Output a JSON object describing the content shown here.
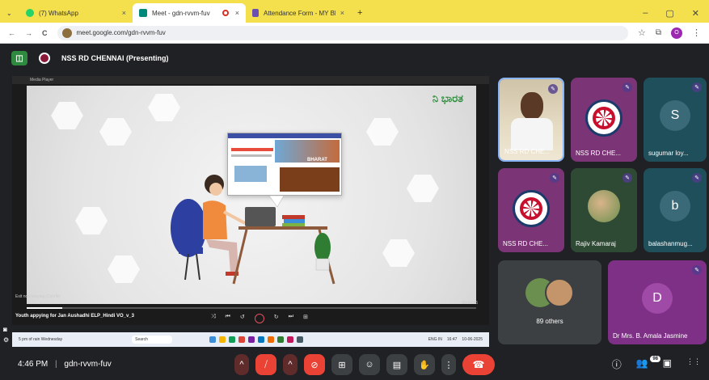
{
  "browser": {
    "tabs": [
      {
        "label": "(7) WhatsApp",
        "color": "#25d366"
      },
      {
        "label": "Meet - gdn-rvvm-fuv",
        "color": "#00897b"
      },
      {
        "label": "Attendance Form - MY Bharat !",
        "color": "#6a4fb3"
      }
    ],
    "new_tab": "+",
    "close_glyph": "×",
    "minimize_glyph": "–",
    "restore_glyph": "▢",
    "window_close_glyph": "✕",
    "back_glyph": "←",
    "forward_glyph": "→",
    "reload_glyph": "C",
    "star_glyph": "☆",
    "extensions_glyph": "⧉",
    "menu_glyph": "⋮",
    "profile_initial": "O",
    "url": "meet.google.com/gdn-rvvm-fuv"
  },
  "meet": {
    "layout_glyph": "◫",
    "presenter": "NSS RD CHENNAI (Presenting)",
    "media_player_title": "Media Player",
    "video_logo": "ನಿ ಭಾರತ",
    "web_card_title": "BHARAT",
    "now_playing": "Youth appying for Jan Aushadhi ELP_Hindi VO_v_3",
    "now_playing_small": "Exit now playing (Ctrl+N)",
    "playback_time": "00:04:56",
    "playback_progress": 0.08,
    "player_controls": [
      "⤨",
      "⏮",
      "↺",
      "↻",
      "⏭",
      "⊞"
    ],
    "taskbar_search": "Search",
    "taskbar_weather": "5 pm of rain Wednesday",
    "taskbar_time": "16:47",
    "taskbar_date": "10-06-2025",
    "taskbar_lang": "ENG IN",
    "participants": [
      {
        "name": "NSS RD CHE...",
        "type": "video",
        "bg": "#3a3a3a"
      },
      {
        "name": "NSS RD CHE...",
        "type": "logo",
        "bg": "#7b3475"
      },
      {
        "name": "sugumar loy...",
        "type": "letter",
        "letter": "S",
        "bg": "#1f4f5b",
        "avatar": "#3a6a78"
      },
      {
        "name": "NSS RD CHE...",
        "type": "logo",
        "bg": "#7b3475"
      },
      {
        "name": "Rajiv Kamaraj",
        "type": "photo",
        "bg": "#2f4a34"
      },
      {
        "name": "balashanmug...",
        "type": "letter",
        "letter": "b",
        "bg": "#1f4f5b",
        "avatar": "#3a6a78"
      },
      {
        "name": "89 others",
        "type": "others",
        "bg": "#3c4043"
      },
      {
        "name": "Dr Mrs. B. Amala Jasmine",
        "type": "letter",
        "letter": "D",
        "bg": "#7e2f86",
        "avatar": "#a04aa8"
      }
    ],
    "mic_glyph": "✎",
    "time": "4:46 PM",
    "separator": "|",
    "meeting_code": "gdn-rvvm-fuv",
    "participant_count": "98",
    "controls": {
      "chevron": "^",
      "mic_off": "⧸",
      "camera_off": "⊘",
      "present": "⊞",
      "emoji": "☺",
      "captions": "▤",
      "raise_hand": "✋",
      "more": "⋮",
      "end_call": "☎"
    },
    "right_icons": {
      "info": "ⓘ",
      "people": "👥",
      "chat": "▣",
      "activities": "⋮⋮"
    }
  }
}
